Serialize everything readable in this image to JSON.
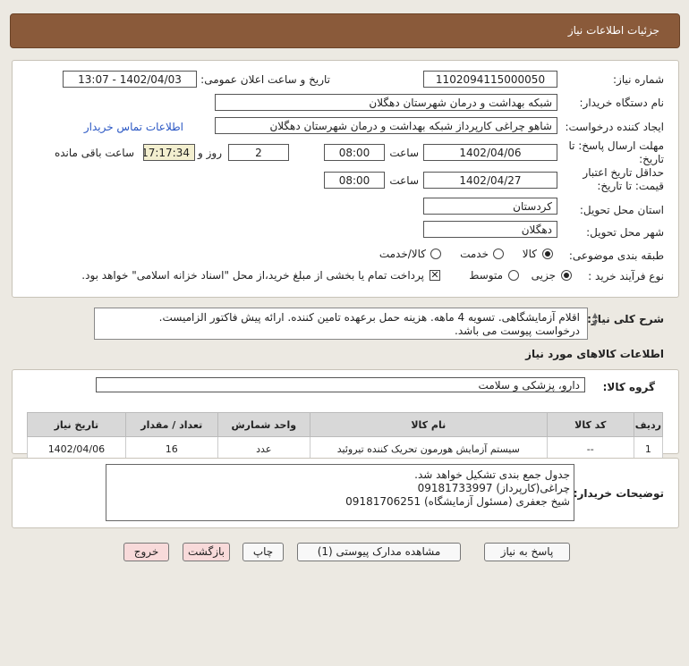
{
  "header": {
    "title": "جزئیات اطلاعات نیاز"
  },
  "form": {
    "need_number_label": "شماره نیاز:",
    "need_number": "1102094115000050",
    "announce_label": "تاریخ و ساعت اعلان عمومی:",
    "announce_value": "1402/04/03 - 13:07",
    "buyer_org_label": "نام دستگاه خریدار:",
    "buyer_org": "شبکه بهداشت و درمان شهرستان دهگلان",
    "creator_label": "ایجاد کننده درخواست:",
    "creator": "شاهو چراغی کارپرداز شبکه بهداشت و درمان شهرستان دهگلان",
    "contact_link": "اطلاعات تماس خریدار",
    "deadline_label": "مهلت ارسال پاسخ: تا تاریخ:",
    "deadline_date": "1402/04/06",
    "time_label": "ساعت",
    "deadline_time": "08:00",
    "days": "2",
    "days_label": "روز و",
    "remaining": "17:17:34",
    "remaining_label": "ساعت باقی مانده",
    "validity_label_1": "حداقل تاریخ اعتبار",
    "validity_label_2": "قیمت: تا تاریخ:",
    "validity_date": "1402/04/27",
    "validity_time": "08:00",
    "province_label": "استان محل تحویل:",
    "province": "کردستان",
    "city_label": "شهر محل تحویل:",
    "city": "دهگلان",
    "category_label": "طبقه بندی موضوعی:",
    "category_options": [
      "کالا",
      "خدمت",
      "کالا/خدمت"
    ],
    "purchase_type_label": "نوع فرآیند خرید :",
    "purchase_options": [
      "جزیی",
      "متوسط"
    ],
    "payment_note": "پرداخت تمام یا بخشی از مبلغ خرید،از محل \"اسناد خزانه اسلامی\" خواهد بود."
  },
  "description": {
    "label": "شرح کلی نیاز:",
    "line1": "اقلام آزمایشگاهی. تسویه 4 ماهه. هزینه حمل برعهده تامین کننده. ارائه پیش فاکتور الزامیست.",
    "line2": "درخواست پیوست می باشد."
  },
  "goods": {
    "section_title": "اطلاعات کالاهای مورد نیاز",
    "group_label": "گروه کالا:",
    "group_value": "دارو، پزشکی و سلامت",
    "columns": [
      "ردیف",
      "کد کالا",
      "نام کالا",
      "واحد شمارش",
      "تعداد / مقدار",
      "تاریخ نیاز"
    ],
    "rows": [
      {
        "row": "1",
        "code": "--",
        "name": "سیستم آزمایش هورمون تحریک کننده تیروئید",
        "unit": "عدد",
        "qty": "16",
        "date": "1402/04/06"
      }
    ]
  },
  "buyer_notes": {
    "label": "توضیحات خریدار:",
    "line1": "جدول جمع بندی تشکیل خواهد شد.",
    "line2": "چراغی(کارپرداز) 09181733997",
    "line3": "شیخ جعفری (مسئول آزمایشگاه) 09181706251"
  },
  "buttons": {
    "reply": "پاسخ به نیاز",
    "attachments": "مشاهده مدارک پیوستی (1)",
    "print": "چاپ",
    "back": "بازگشت",
    "exit": "خروج"
  }
}
